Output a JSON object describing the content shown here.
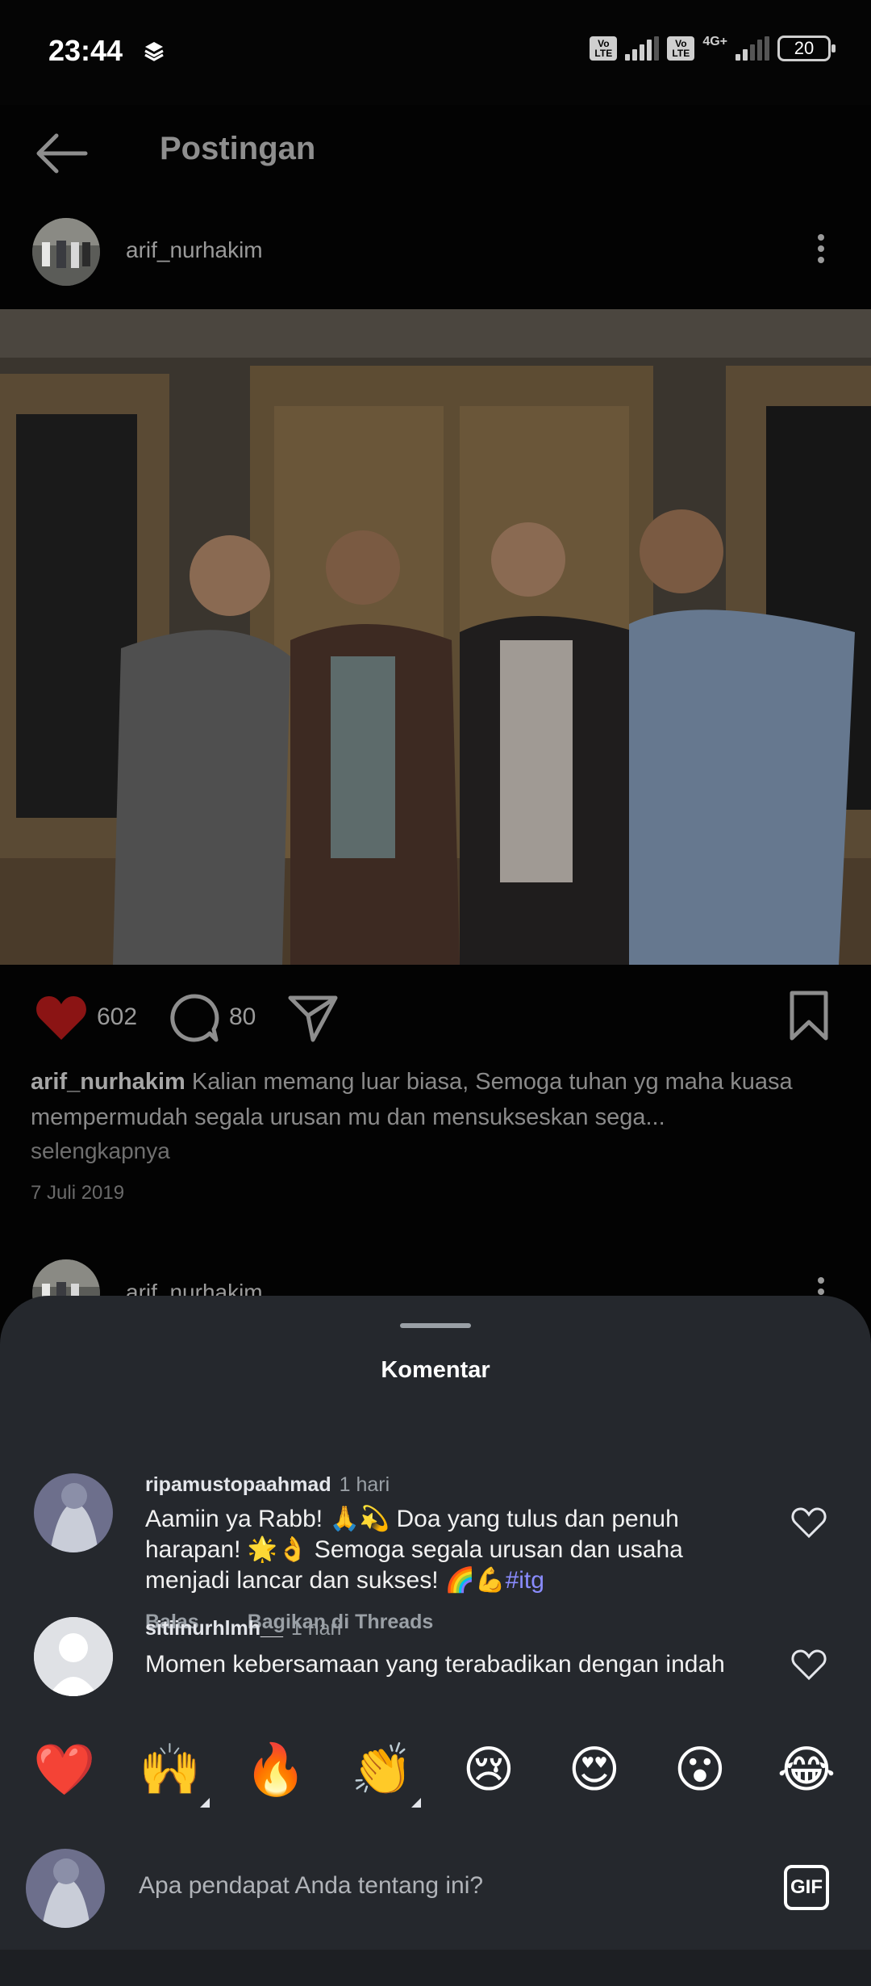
{
  "status_bar": {
    "time": "23:44",
    "network": "4G+",
    "volte_label": "Vo LTE",
    "battery": "20"
  },
  "header": {
    "title": "Postingan"
  },
  "post": {
    "username": "arif_nurhakim",
    "likes": "602",
    "comments_count": "80",
    "caption_user": "arif_nurhakim",
    "caption_text": " Kalian memang luar biasa, Semoga tuhan yg maha kuasa mempermudah segala urusan mu dan mensukseskan sega...",
    "more_label": "selengkapnya",
    "date": "7 Juli 2019"
  },
  "next_post": {
    "username": "arif_nurhakim"
  },
  "sheet": {
    "title": "Komentar",
    "comments": [
      {
        "user": "ripamustopaahmad",
        "time": "1 hari",
        "text": "Aamiin ya Rabb! 🙏💫 Doa yang tulus dan penuh harapan! 🌟👌 Semoga segala urusan dan usaha menjadi lancar dan sukses! 🌈💪",
        "hashtag": "#itg",
        "reply_label": "Balas",
        "share_label": "Bagikan di Threads"
      },
      {
        "user": "sitiinurhlmh__",
        "time": "1 hari",
        "text": "Momen kebersamaan yang terabadikan dengan indah"
      }
    ],
    "emoji_bar": [
      "❤️",
      "🙌",
      "🔥",
      "👏",
      "😢",
      "😍",
      "😮",
      "😂"
    ],
    "input_placeholder": "Apa pendapat Anda tentang ini?",
    "gif_label": "GIF"
  },
  "colors": {
    "sheet_bg": "#25282d",
    "like_red": "#8b1414",
    "hashtag": "#8a8cff"
  }
}
